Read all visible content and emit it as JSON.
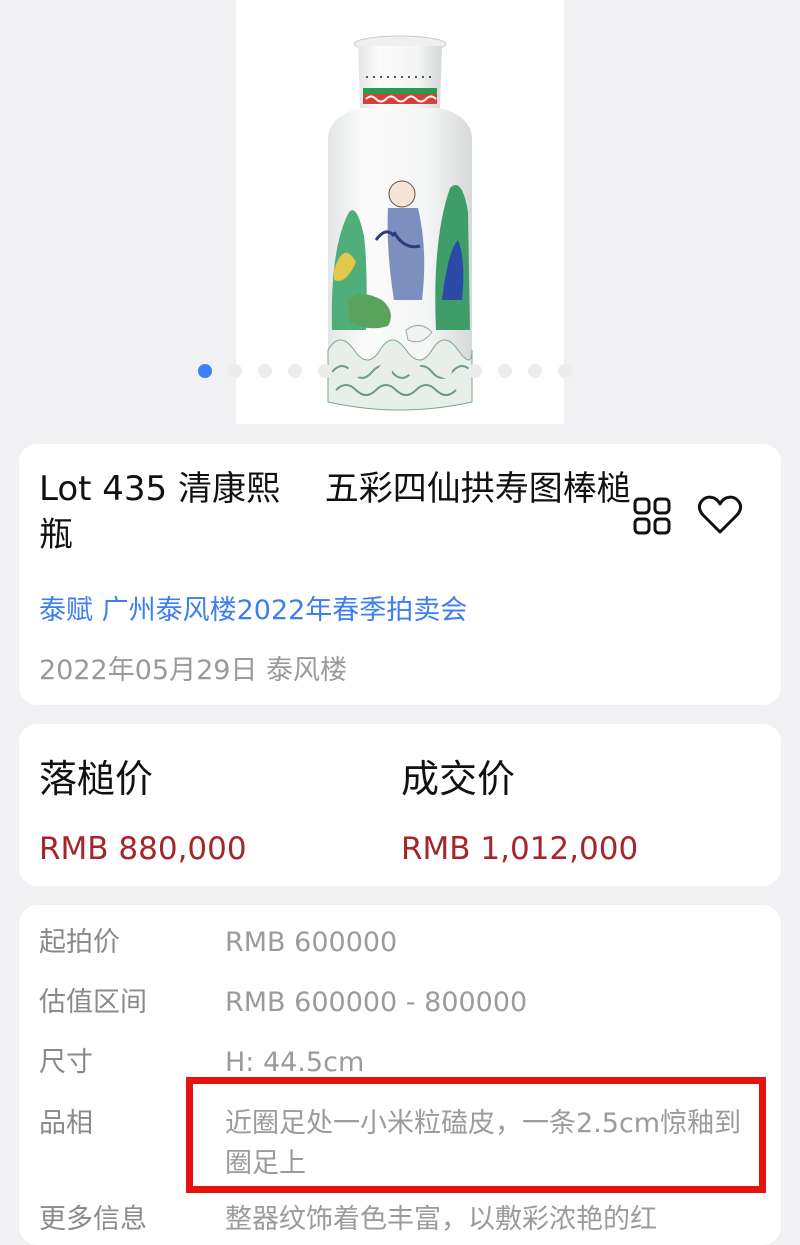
{
  "gallery": {
    "image_icon": "porcelain-vase-image",
    "dot_count": 13,
    "active_dot": 0,
    "active_color": "#3f7ff5"
  },
  "lot": {
    "title": "Lot 435 清康熙　 五彩四仙拱寿图棒槌瓶",
    "sale_link": "泰赋 广州泰风楼2022年春季拍卖会",
    "sale_meta": "2022年05月29日 泰风楼"
  },
  "prices": {
    "hammer_label": "落槌价",
    "hammer_value": "RMB 880,000",
    "deal_label": "成交价",
    "deal_value": "RMB 1,012,000",
    "price_color": "#a5262a"
  },
  "details": [
    {
      "label": "起拍价",
      "value": "RMB 600000"
    },
    {
      "label": "估值区间",
      "value": "RMB 600000 - 800000"
    },
    {
      "label": "尺寸",
      "value": "H: 44.5cm"
    },
    {
      "label": "品相",
      "value": "近圈足处一小米粒磕皮，一条2.5cm惊釉到圈足上"
    },
    {
      "label": "更多信息",
      "value": "整器纹饰着色丰富，以敷彩浓艳的红"
    }
  ],
  "accent_colors": {
    "link": "#3d7ef0",
    "highlight": "#e8130f"
  }
}
